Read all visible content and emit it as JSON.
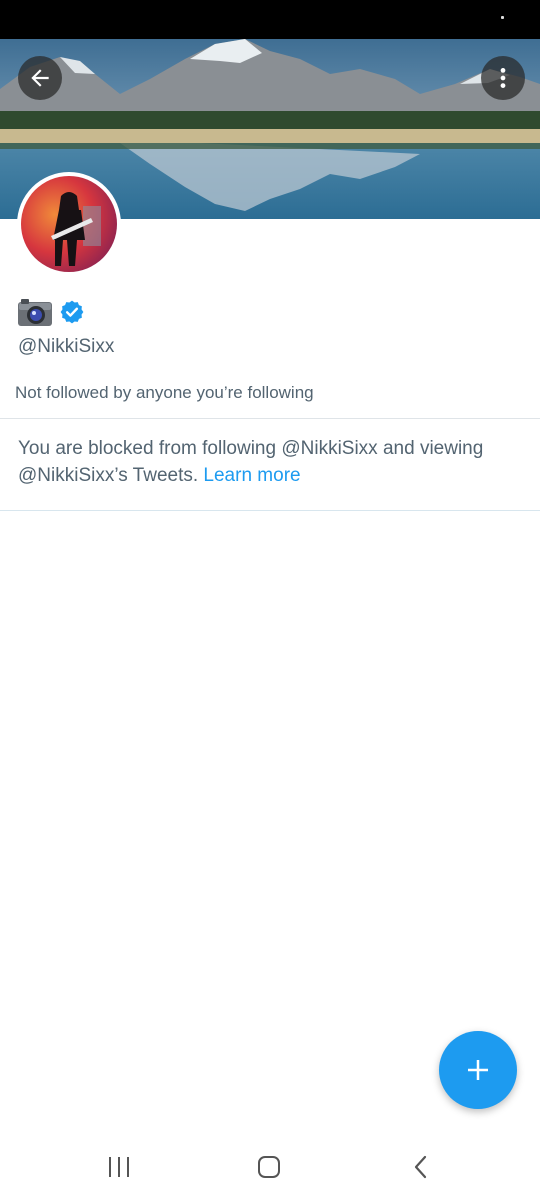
{
  "profile": {
    "display_name_icon": "camera-emoji",
    "verified_badge": "verified-checkmark-icon",
    "handle": "@NikkiSixx",
    "followers_note": "Not followed by anyone you’re following"
  },
  "blocked_notice": {
    "text": "You are blocked from following @NikkiSixx and viewing @NikkiSixx’s Tweets.",
    "link_label": "Learn more"
  },
  "header": {
    "back_icon": "arrow-left-icon",
    "more_icon": "more-vertical-icon"
  },
  "fab": {
    "icon": "plus-icon"
  },
  "system_nav": {
    "recents_icon": "recents-icon",
    "home_icon": "home-icon",
    "back_icon": "back-chevron-icon"
  },
  "colors": {
    "accent": "#1d9bf0",
    "secondary_text": "#536471",
    "status_bar": "#000000"
  }
}
